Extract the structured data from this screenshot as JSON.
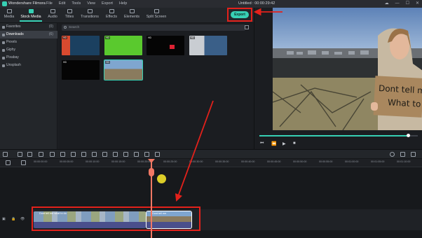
{
  "titlebar": {
    "app_name": "Wondershare Filmora",
    "menu": [
      "File",
      "Edit",
      "Tools",
      "View",
      "Export",
      "Help"
    ],
    "project": "Untitled : 00:00:29:42"
  },
  "toolbar": {
    "tabs": [
      {
        "label": "Media",
        "icon": "folder-icon"
      },
      {
        "label": "Stock Media",
        "icon": "stock-media-icon"
      },
      {
        "label": "Audio",
        "icon": "music-icon"
      },
      {
        "label": "Titles",
        "icon": "text-icon"
      },
      {
        "label": "Transitions",
        "icon": "transition-icon"
      },
      {
        "label": "Effects",
        "icon": "effects-icon"
      },
      {
        "label": "Elements",
        "icon": "elements-icon"
      },
      {
        "label": "Split Screen",
        "icon": "split-screen-icon"
      }
    ],
    "active_tab": "Stock Media",
    "export_label": "Export"
  },
  "sidebar": {
    "items": [
      {
        "label": "Favorites",
        "count": "(0)"
      },
      {
        "label": "Downloads",
        "count": "(6)"
      },
      {
        "label": "Pexels",
        "count": ""
      },
      {
        "label": "Giphy",
        "count": ""
      },
      {
        "label": "Pixabay",
        "count": ""
      },
      {
        "label": "Unsplash",
        "count": ""
      }
    ],
    "selected": "Downloads"
  },
  "media": {
    "search_placeholder": "Search",
    "thumbnails": [
      {
        "badge": "HD"
      },
      {
        "badge": "HD"
      },
      {
        "badge": "HD"
      },
      {
        "badge": "HD"
      },
      {
        "badge": "HD"
      },
      {
        "badge": "HD"
      }
    ]
  },
  "preview": {
    "sign_line1": "Dont tell me",
    "sign_line2": "What to Do",
    "progress": 0.94
  },
  "timeline": {
    "ruler_ticks": [
      "00:00:00:00",
      "00:00:05:00",
      "00:00:10:00",
      "00:00:15:00",
      "00:00:20:00",
      "00:00:25:00",
      "00:00:30:00",
      "00:00:35:00",
      "00:00:40:00",
      "00:00:45:00",
      "00:00:50:00",
      "00:00:55:00",
      "00:01:00:00",
      "00:01:05:00",
      "00:01:10:00"
    ],
    "clips": [
      {
        "label": "Dont tell me what to do"
      },
      {
        "label": "Dont tell me"
      }
    ]
  },
  "colors": {
    "accent": "#37d0b4",
    "annotation": "#e3211b",
    "playhead": "#f07864"
  }
}
